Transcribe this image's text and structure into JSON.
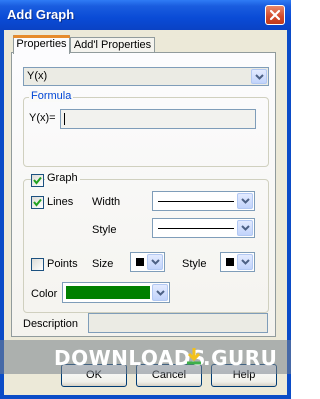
{
  "window": {
    "title": "Add Graph"
  },
  "tabs": [
    {
      "label": "Properties",
      "active": true
    },
    {
      "label": "Add'l Properties",
      "active": false
    }
  ],
  "function_select": {
    "value": "Y(x)"
  },
  "formula": {
    "legend": "Formula",
    "label": "Y(x)=",
    "value": ""
  },
  "graph": {
    "legend": "Graph",
    "checked": true,
    "lines": {
      "label": "Lines",
      "checked": true,
      "width_label": "Width",
      "style_label": "Style"
    },
    "points": {
      "label": "Points",
      "checked": false,
      "size_label": "Size",
      "style_label": "Style"
    },
    "color_label": "Color",
    "color_value": "#008000"
  },
  "description": {
    "label": "Description",
    "value": ""
  },
  "buttons": {
    "ok": "OK",
    "cancel": "Cancel",
    "help": "Help"
  },
  "watermark": {
    "text": "DOWNLOADS",
    "suffix": ".GURU"
  }
}
